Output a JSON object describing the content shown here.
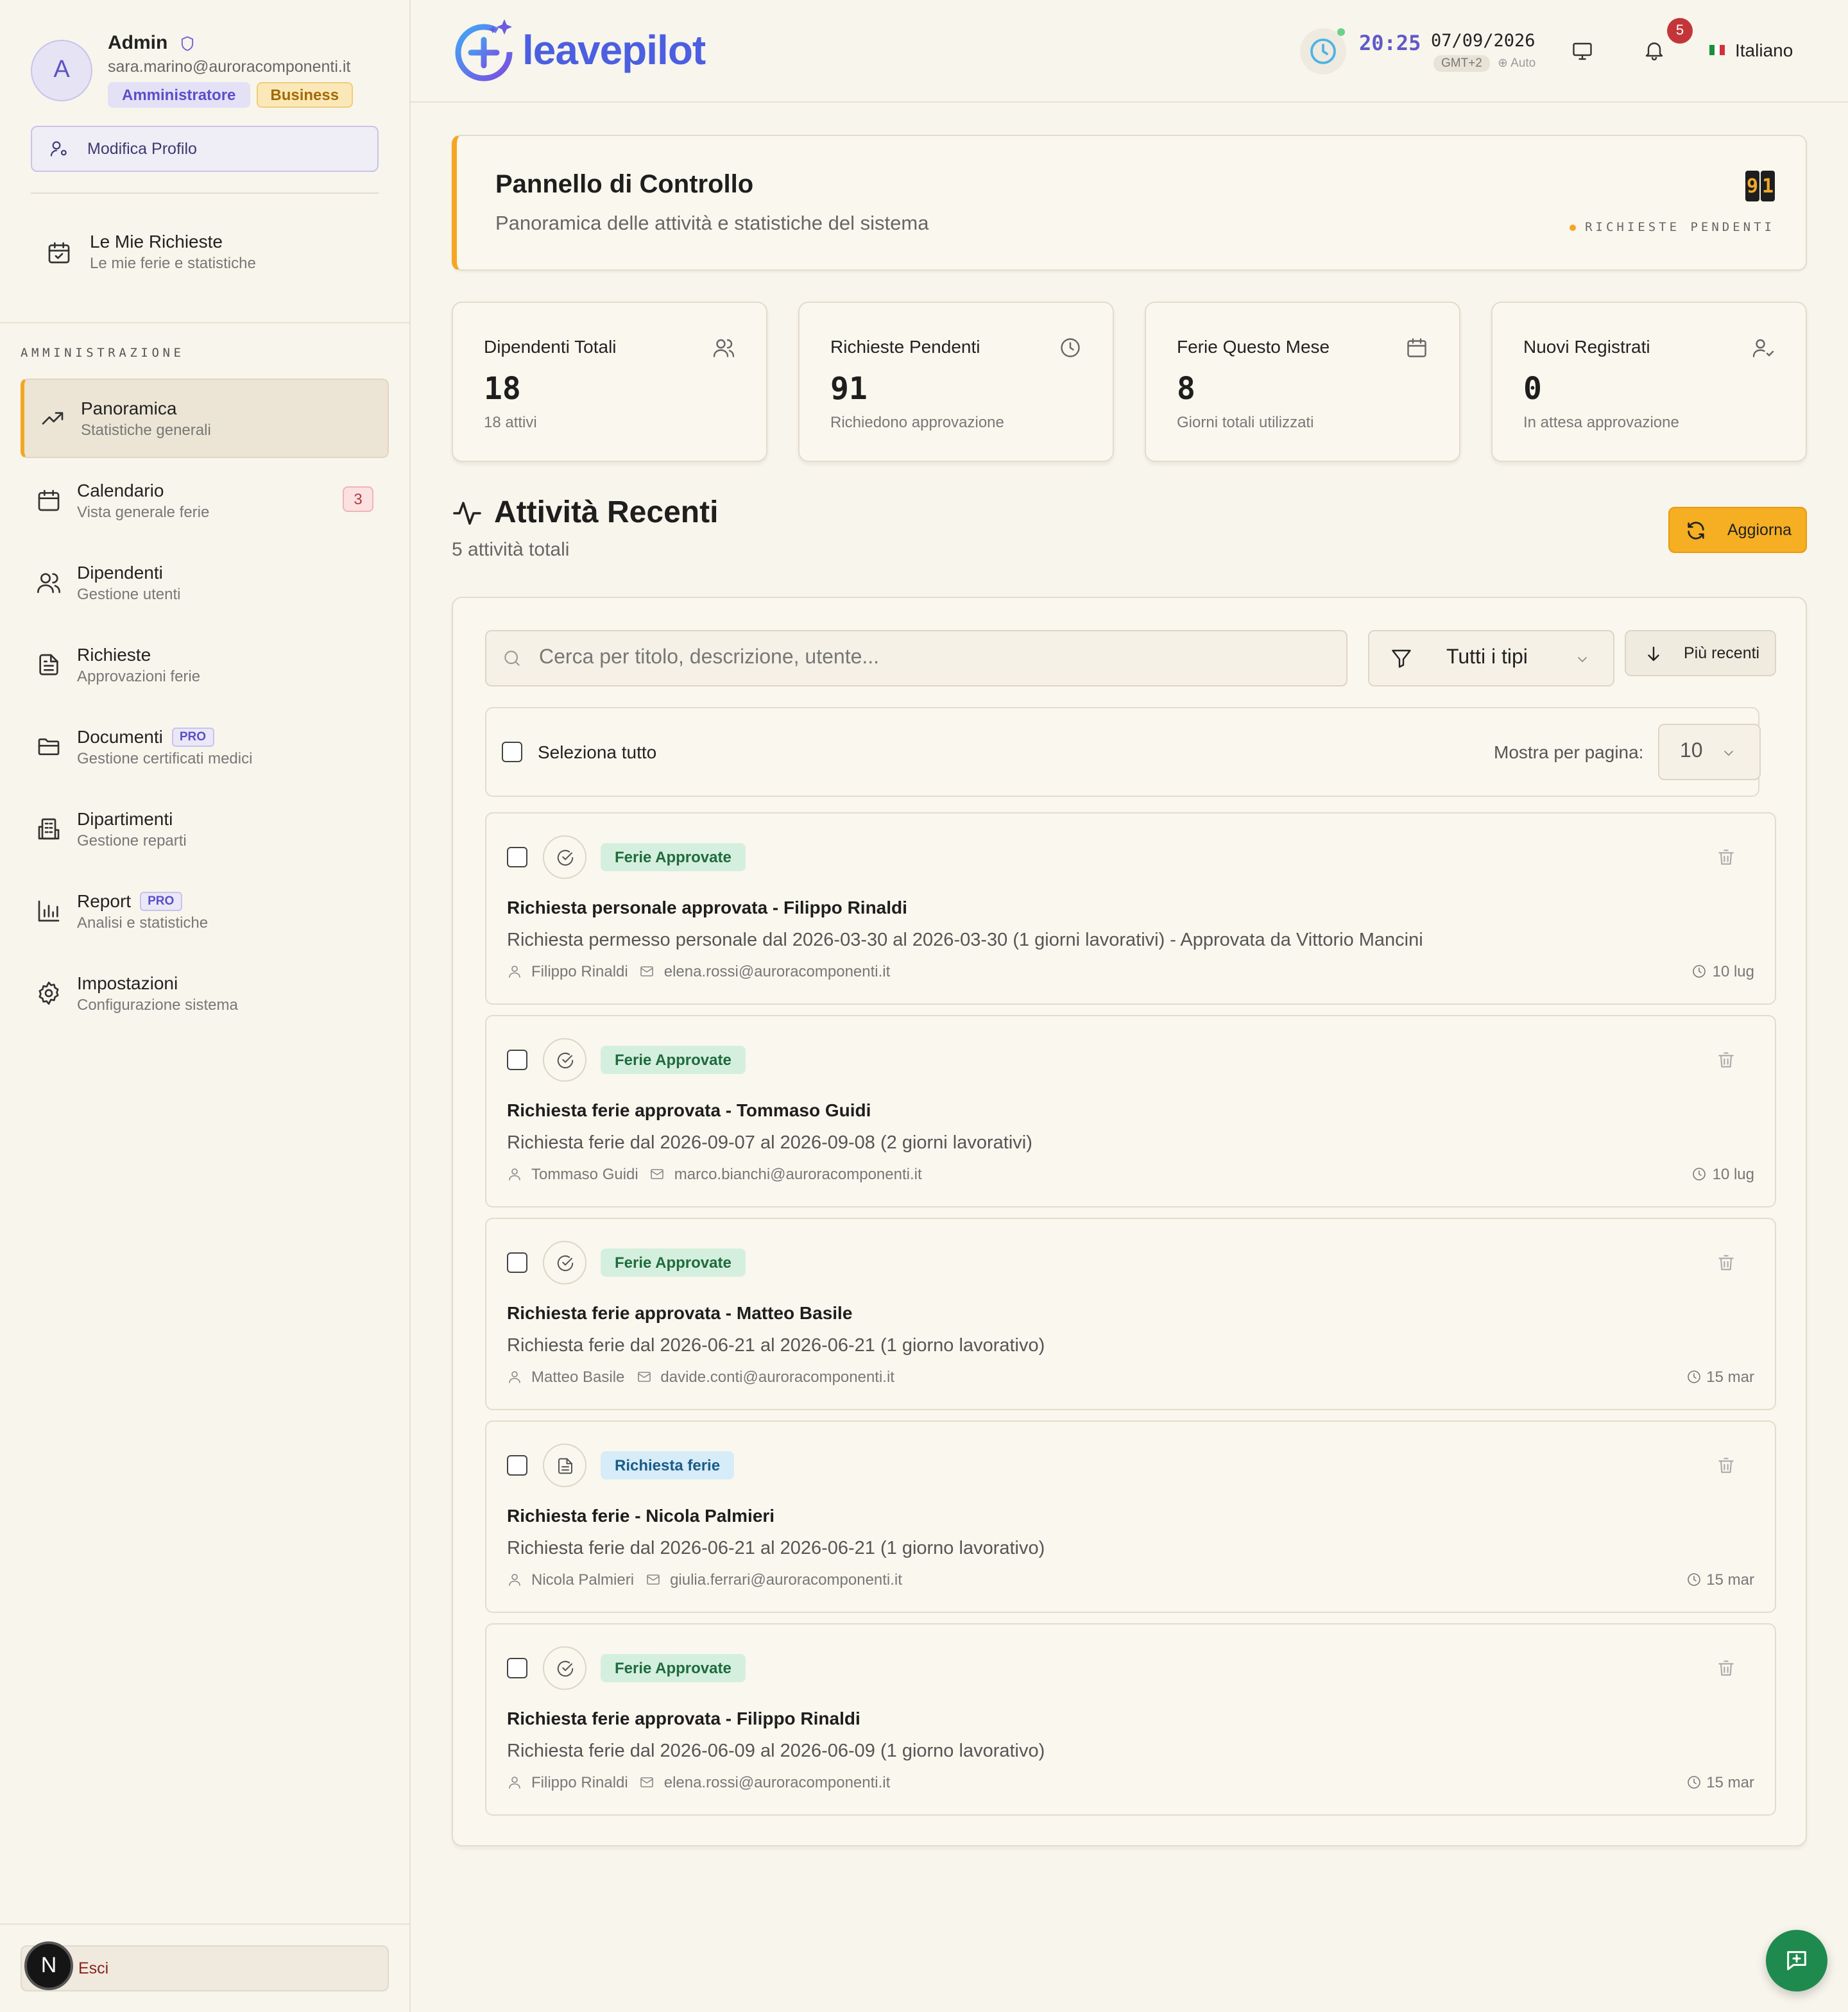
{
  "user": {
    "initial": "A",
    "name": "Admin",
    "email": "sara.marino@auroracomponenti.it",
    "role_badge": "Amministratore",
    "plan_badge": "Business",
    "edit_profile": "Modifica Profilo"
  },
  "my_requests": {
    "title": "Le Mie Richieste",
    "subtitle": "Le mie ferie e statistiche"
  },
  "section_label": "AMMINISTRAZIONE",
  "nav": [
    {
      "label": "Panoramica",
      "subtitle": "Statistiche generali",
      "icon": "trending-up-icon",
      "active": true
    },
    {
      "label": "Calendario",
      "subtitle": "Vista generale ferie",
      "icon": "calendar-icon",
      "count": "3"
    },
    {
      "label": "Dipendenti",
      "subtitle": "Gestione utenti",
      "icon": "users-icon"
    },
    {
      "label": "Richieste",
      "subtitle": "Approvazioni ferie",
      "icon": "file-text-icon"
    },
    {
      "label": "Documenti",
      "subtitle": "Gestione certificati medici",
      "icon": "folder-icon",
      "pro": "PRO"
    },
    {
      "label": "Dipartimenti",
      "subtitle": "Gestione reparti",
      "icon": "building-icon"
    },
    {
      "label": "Report",
      "subtitle": "Analisi e statistiche",
      "icon": "bar-chart-icon",
      "pro": "PRO"
    },
    {
      "label": "Impostazioni",
      "subtitle": "Configurazione sistema",
      "icon": "gear-icon"
    }
  ],
  "logout": "Esci",
  "corner_badge": "N",
  "header": {
    "brand": "leavepilot",
    "time": "20:25",
    "date": "07/09/2026",
    "timezone": "GMT+2",
    "tz_mode": "Auto",
    "notifications": "5",
    "language": "Italiano"
  },
  "dashboard": {
    "title": "Pannello di Controllo",
    "subtitle": "Panoramica delle attività e statistiche del sistema",
    "pending_digits": [
      "9",
      "1"
    ],
    "pending_label": "RICHIESTE PENDENTI"
  },
  "stats": [
    {
      "title": "Dipendenti Totali",
      "value": "18",
      "note": "18 attivi",
      "icon": "users-icon"
    },
    {
      "title": "Richieste Pendenti",
      "value": "91",
      "note": "Richiedono approvazione",
      "icon": "clock-icon"
    },
    {
      "title": "Ferie Questo Mese",
      "value": "8",
      "note": "Giorni totali utilizzati",
      "icon": "calendar-icon"
    },
    {
      "title": "Nuovi Registrati",
      "value": "0",
      "note": "In attesa approvazione",
      "icon": "user-check-icon"
    }
  ],
  "activity": {
    "title": "Attività Recenti",
    "count_text": "5 attività totali",
    "refresh": "Aggiorna",
    "search_placeholder": "Cerca per titolo, descrizione, utente...",
    "filter": "Tutti i tipi",
    "sort": "Più recenti",
    "select_all": "Seleziona tutto",
    "per_page_label": "Mostra per pagina:",
    "per_page": "10",
    "items": [
      {
        "tag": "Ferie Approvate",
        "kind": "ok",
        "title": "Richiesta personale approvata - Filippo Rinaldi",
        "desc": "Richiesta permesso personale dal 2026-03-30 al 2026-03-30 (1 giorni lavorativi) - Approvata da Vittorio Mancini",
        "user": "Filippo Rinaldi",
        "email": "elena.rossi@auroracomponenti.it",
        "when": "10 lug"
      },
      {
        "tag": "Ferie Approvate",
        "kind": "ok",
        "title": "Richiesta ferie approvata - Tommaso Guidi",
        "desc": "Richiesta ferie dal 2026-09-07 al 2026-09-08 (2 giorni lavorativi)",
        "user": "Tommaso Guidi",
        "email": "marco.bianchi@auroracomponenti.it",
        "when": "10 lug"
      },
      {
        "tag": "Ferie Approvate",
        "kind": "ok",
        "title": "Richiesta ferie approvata - Matteo Basile",
        "desc": "Richiesta ferie dal 2026-06-21 al 2026-06-21 (1 giorno lavorativo)",
        "user": "Matteo Basile",
        "email": "davide.conti@auroracomponenti.it",
        "when": "15 mar"
      },
      {
        "tag": "Richiesta ferie",
        "kind": "req",
        "title": "Richiesta ferie - Nicola Palmieri",
        "desc": "Richiesta ferie dal 2026-06-21 al 2026-06-21 (1 giorno lavorativo)",
        "user": "Nicola Palmieri",
        "email": "giulia.ferrari@auroracomponenti.it",
        "when": "15 mar"
      },
      {
        "tag": "Ferie Approvate",
        "kind": "ok",
        "title": "Richiesta ferie approvata - Filippo Rinaldi",
        "desc": "Richiesta ferie dal 2026-06-09 al 2026-06-09 (1 giorno lavorativo)",
        "user": "Filippo Rinaldi",
        "email": "elena.rossi@auroracomponenti.it",
        "when": "15 mar"
      }
    ]
  },
  "colors": {
    "accent": "#f5a623",
    "brand": "#4b5fe0",
    "approved": "#d5efdf",
    "request": "#d6ecf8",
    "chat": "#1f8a4e"
  }
}
